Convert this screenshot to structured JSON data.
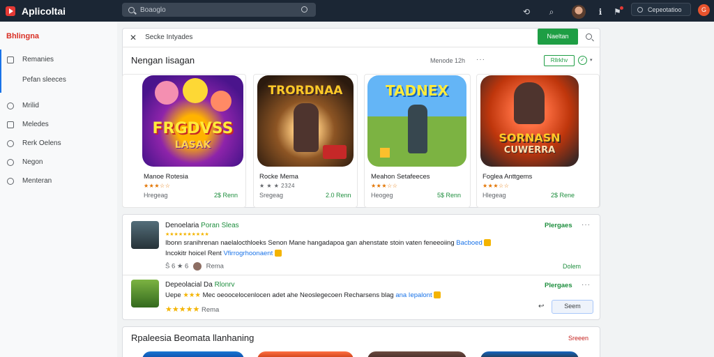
{
  "topbar": {
    "app_name": "Aplicoltai",
    "search_placeholder": "Boaoglo",
    "account_label": "Cepeotatioo",
    "profile_initial": "G"
  },
  "sidebar": {
    "title": "Bhlingna",
    "items": [
      {
        "label": "Remanies",
        "icon": "list-icon"
      },
      {
        "label": "Pefan sleeces",
        "icon": "none"
      },
      {
        "label": "Mrilid",
        "icon": "chat-icon"
      },
      {
        "label": "Meledes",
        "icon": "list-icon"
      },
      {
        "label": "Rerk Oelens",
        "icon": "circle-icon"
      },
      {
        "label": "Negon",
        "icon": "circle-icon"
      },
      {
        "label": "Menteran",
        "icon": "chat-icon"
      }
    ]
  },
  "filter": {
    "text": "Secke Intyades",
    "button_label": "Naeltan"
  },
  "featured": {
    "title": "Nengan Iisagan",
    "meta": "Menode 12h",
    "pill_label": "Rllrkhv",
    "apps": [
      {
        "name": "Manoe Rotesia",
        "stars": "★★★☆☆",
        "category": "Hregeag",
        "price": "2$ Renn",
        "art_title": "FRGDVSS",
        "art_sub": "LASAK"
      },
      {
        "name": "Rocke Mema",
        "stars": "★ ★ ★ 2324",
        "category": "Sregeag",
        "price": "2.0 Renn",
        "art_title": "TRORDNAA",
        "art_sub": ""
      },
      {
        "name": "Meahon Setafeeces",
        "stars": "★★★☆☆",
        "category": "Heogeg",
        "price": "5$ Renn",
        "art_title": "TADNEX",
        "art_sub": ""
      },
      {
        "name": "Foglea Anttgems",
        "stars": "★★★☆☆",
        "category": "Hlegeag",
        "price": "2$ Rene",
        "art_title": "SORNASN",
        "art_sub": "CUWERRA"
      }
    ]
  },
  "reviews": [
    {
      "title": "Denoelaria",
      "title_green": "Poran Sleas",
      "stars": "★★★★★★★★★★",
      "body_line1": "Ibonn sranihrenan naelalocthloeks Senon Mane hangadapoa gan ahenstate stoin vaten feneeoiing",
      "body_line1_link": "Bacboed",
      "body_line2": "Incokitr hoicel Rent",
      "body_line2_link": "Vfirrogrhoonaent",
      "meta": "Ŝ 6 ★ 6",
      "meta_name": "Rema",
      "action": "Plergaes",
      "link": "Dolem"
    },
    {
      "title": "Depeolacial Da",
      "title_green": "Rlonrv",
      "stars": "★★★",
      "prefix": "Uepe",
      "body_line1": "Mec oeoocelocenlocen adet ahe Neoslegecoen Recharsens blag",
      "body_line1_link": "ana Iepalont",
      "meta_stars": "★★★★★",
      "meta_name": "Rema",
      "action": "Plergaes",
      "button": "Seem"
    }
  ],
  "bottom": {
    "title": "Rpaleesia Beomata llanhaning",
    "link": "Sreeen"
  }
}
